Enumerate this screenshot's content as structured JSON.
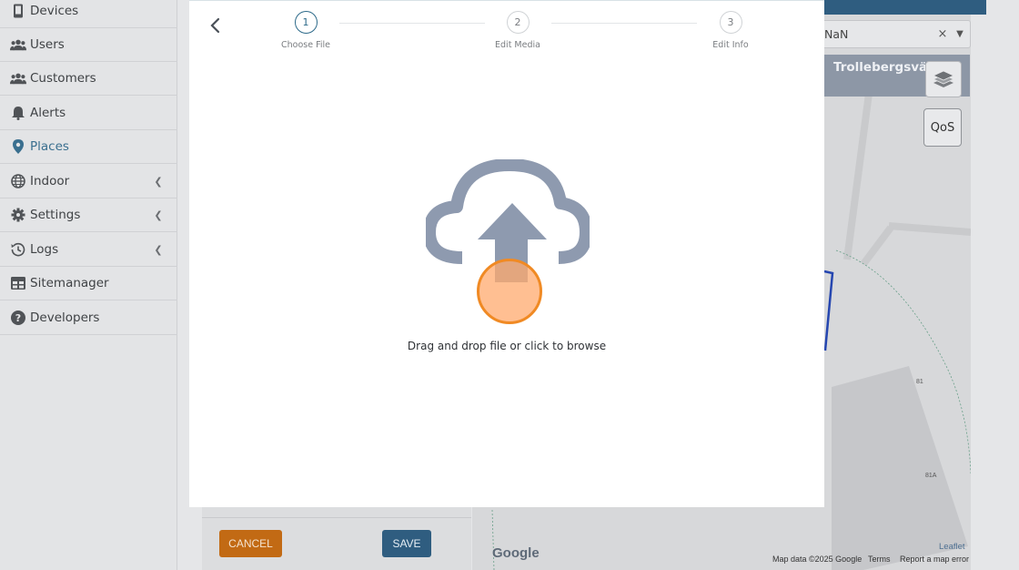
{
  "sidebar": {
    "items": [
      {
        "label": "Devices",
        "icon": "device-icon",
        "expandable": false,
        "active": false
      },
      {
        "label": "Users",
        "icon": "users-icon",
        "expandable": false,
        "active": false
      },
      {
        "label": "Customers",
        "icon": "customers-icon",
        "expandable": false,
        "active": false
      },
      {
        "label": "Alerts",
        "icon": "bell-icon",
        "expandable": false,
        "active": false
      },
      {
        "label": "Places",
        "icon": "map-pin-icon",
        "expandable": false,
        "active": true
      },
      {
        "label": "Indoor",
        "icon": "globe-icon",
        "expandable": true,
        "active": false
      },
      {
        "label": "Settings",
        "icon": "gear-icon",
        "expandable": true,
        "active": false
      },
      {
        "label": "Logs",
        "icon": "history-icon",
        "expandable": true,
        "active": false
      },
      {
        "label": "Sitemanager",
        "icon": "table-icon",
        "expandable": false,
        "active": false
      },
      {
        "label": "Developers",
        "icon": "help-icon",
        "expandable": false,
        "active": false
      }
    ]
  },
  "form": {
    "cancel_label": "CANCEL",
    "save_label": "SAVE"
  },
  "map": {
    "select_value": "NaN",
    "clear_symbol": "×",
    "road_label": "Trollebergsväg",
    "qos_label": "QoS",
    "google_logo": "Google",
    "attribution": "Map data ©2025 Google",
    "terms": "Terms",
    "report": "Report a map error",
    "leaflet": "Leaflet",
    "num_81": "81",
    "num_81a": "81A"
  },
  "modal": {
    "steps": [
      {
        "number": "1",
        "label": "Choose File",
        "active": true
      },
      {
        "number": "2",
        "label": "Edit Media",
        "active": false
      },
      {
        "number": "3",
        "label": "Edit Info",
        "active": false
      }
    ],
    "dropzone_text": "Drag and drop file or click to browse",
    "upload_icon_color": "#8e9aaf"
  },
  "colors": {
    "accent": "#2f5d80",
    "cancel": "#c26a14",
    "active_nav": "#3a6f8f",
    "click_indicator": "#f08a24"
  }
}
